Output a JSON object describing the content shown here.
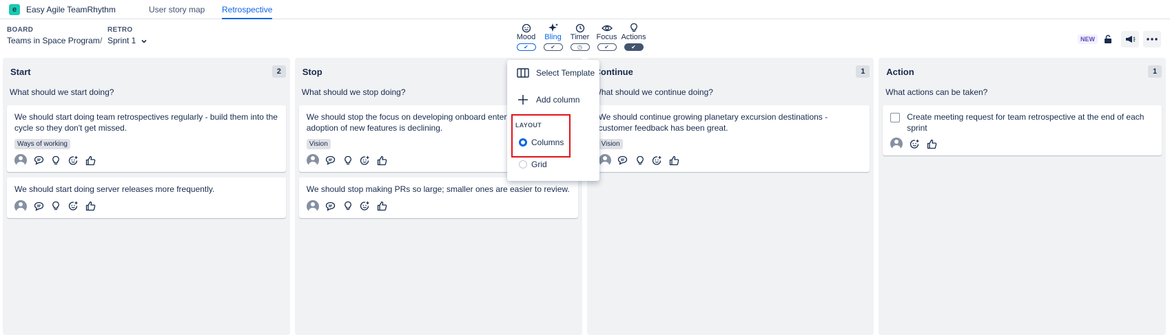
{
  "app": {
    "name": "Easy Agile TeamRhythm",
    "logo_letter": "e"
  },
  "nav": {
    "tabs": [
      {
        "label": "User story map"
      },
      {
        "label": "Retrospective"
      }
    ],
    "active": "Retrospective"
  },
  "breadcrumb": {
    "board_label": "BOARD",
    "board_value": "Teams in Space Program",
    "separator": "/",
    "retro_label": "RETRO",
    "retro_value": "Sprint 1"
  },
  "toolbar": {
    "tools": [
      {
        "label": "Mood",
        "icon": "smile-icon",
        "pill": "✔"
      },
      {
        "label": "Bling",
        "icon": "sparkles-icon",
        "pill": "✔"
      },
      {
        "label": "Timer",
        "icon": "clock-icon",
        "pill": "◷"
      },
      {
        "label": "Focus",
        "icon": "eye-icon",
        "pill": "✔"
      },
      {
        "label": "Actions",
        "icon": "lightbulb-icon",
        "pill": "✔"
      }
    ]
  },
  "topright": {
    "new_badge": "NEW"
  },
  "dropdown": {
    "select_template": "Select Template",
    "add_column": "Add column",
    "layout_label": "LAYOUT",
    "options": [
      {
        "label": "Columns",
        "selected": true
      },
      {
        "label": "Grid",
        "selected": false
      }
    ]
  },
  "columns": [
    {
      "title": "Start",
      "count": "2",
      "question": "What should we start doing?",
      "cards": [
        {
          "text": "We should start doing team retrospectives regularly - build them into the cycle so they don't get missed.",
          "tag": "Ways of working"
        },
        {
          "text": "We should start doing server releases more frequently.",
          "tag": ""
        }
      ]
    },
    {
      "title": "Stop",
      "count": "",
      "question": "What should we stop doing?",
      "cards": [
        {
          "text": "We should stop the focus on developing onboard entertainment - adoption of new features is declining.",
          "tag": "Vision"
        },
        {
          "text": "We should stop making PRs so large; smaller ones are easier to review.",
          "tag": ""
        }
      ]
    },
    {
      "title": "Continue",
      "count": "1",
      "question": "What should we continue doing?",
      "cards": [
        {
          "text": "We should continue growing planetary excursion destinations - customer feedback has been great.",
          "tag": "Vision"
        }
      ]
    },
    {
      "title": "Action",
      "count": "1",
      "question": "What actions can be taken?",
      "cards": [
        {
          "text": "Create meeting request for team retrospective at the end of each sprint",
          "tag": ""
        }
      ]
    }
  ]
}
